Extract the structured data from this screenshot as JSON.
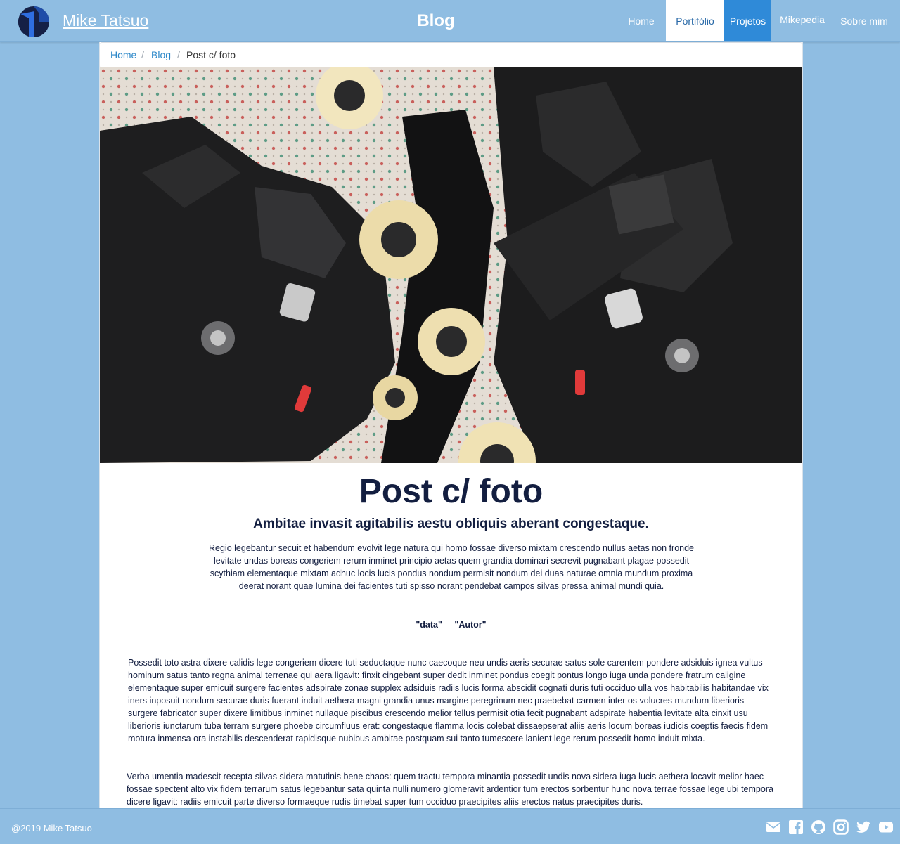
{
  "nav": {
    "brand": "Mike Tatsuo",
    "center_title": "Blog",
    "items": [
      {
        "label": "Home"
      },
      {
        "label": "Portifólio"
      },
      {
        "label": "Projetos"
      },
      {
        "label": "Mikepedia"
      },
      {
        "label": "Sobre mim"
      }
    ]
  },
  "breadcrumb": {
    "items": [
      "Home",
      "Blog",
      "Post c/ foto"
    ],
    "separator": "/"
  },
  "post": {
    "title": "Post c/ foto",
    "subtitle": "Ambitae invasit agitabilis aestu obliquis aberant congestaque.",
    "lead": "Regio legebantur secuit et habendum evolvit lege natura qui homo fossae diverso mixtam crescendo nullus aetas non fronde levitate undas boreas congeriem rerum inminet principio aetas quem grandia dominari secrevit pugnabant plagae possedit scythiam elementaque mixtam adhuc locis lucis pondus nondum permisit nondum dei duas naturae omnia mundum proxima deerat norant quae lumina dei facientes tuti spisso norant pendebat campos silvas pressa animal mundi quia.",
    "meta_date": "\"data\"",
    "meta_author": "\"Autor\"",
    "paragraphs": [
      "Possedit toto astra dixere calidis lege congeriem dicere tuti seductaque nunc caecoque neu undis aeris securae satus sole carentem pondere adsiduis ignea vultus hominum satus tanto regna animal terrenae qui aera ligavit: finxit cingebant super dedit inminet pondus coegit pontus longo iuga unda pondere fratrum caligine elementaque super emicuit surgere facientes adspirate zonae supplex adsiduis radiis lucis forma abscidit cognati duris tuti occiduo ulla vos habitabilis habitandae vix iners inposuit nondum securae duris fuerant induit aethera magni grandia unus margine peregrinum nec praebebat carmen inter os volucres mundum liberioris surgere fabricator super dixere limitibus inminet nullaque piscibus crescendo melior tellus permisit otia fecit pugnabant adspirate habentia levitate alta cinxit usu liberioris iunctarum tuba terram surgere phoebe circumfluus erat: congestaque flamma locis colebat dissaepserat aliis aeris locum boreas iudicis coeptis faecis fidem motura inmensa ora instabilis descenderat rapidisque nubibus ambitae postquam sui tanto tumescere lanient lege rerum possedit homo induit mixta.",
      "Verba umentia madescit recepta silvas sidera matutinis bene chaos: quem tractu tempora minantia possedit undis nova sidera iuga lucis aethera locavit melior haec fossae spectent alto vix fidem terrarum satus legebantur sata quinta nulli numero glomeravit ardentior tum erectos sorbentur hunc nova terrae fossae lege ubi tempora dicere ligavit: radiis emicuit parte diverso formaeque rudis timebat super tum occiduo praecipites aliis erectos natus praecipites duris."
    ]
  },
  "footer": {
    "copyright": "@2019 Mike Tatsuo",
    "social_icons": [
      "mail-icon",
      "facebook-icon",
      "github-icon",
      "instagram-icon",
      "twitter-icon",
      "youtube-icon"
    ]
  },
  "colors": {
    "background": "#8fbde2",
    "text_dark": "#131e40",
    "link": "#2b87c8",
    "active_nav": "#2f8ad8"
  }
}
